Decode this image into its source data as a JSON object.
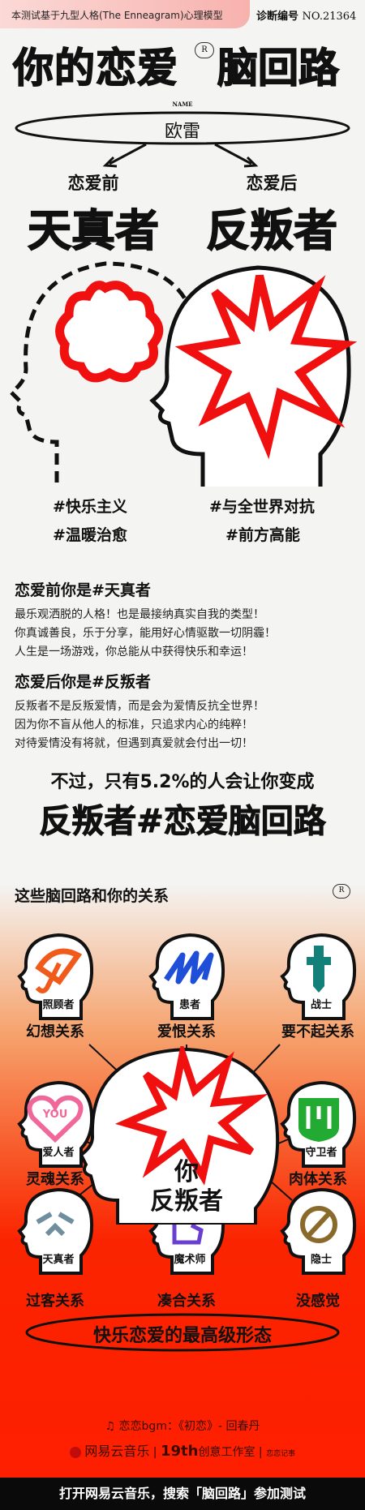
{
  "header": {
    "banner": "本测试基于九型人格(The Enneagram)心理模型",
    "diag_label": "诊断编号",
    "diag_no": "NO.21364"
  },
  "title": {
    "part1": "你的恋爱",
    "part2": "脑回路",
    "badge": "R"
  },
  "name": {
    "label": "NAME",
    "value": "欧雷"
  },
  "before": {
    "label": "恋爱前",
    "type": "天真者",
    "tags": [
      "#快乐主义",
      "#温暖治愈"
    ]
  },
  "after": {
    "label": "恋爱后",
    "type": "反叛者",
    "tags": [
      "#与全世界对抗",
      "#前方高能"
    ]
  },
  "desc": [
    {
      "heading": "恋爱前你是#天真者",
      "lines": [
        "最乐观洒脱的人格！也是最接纳真实自我的类型！",
        "你真诚善良，乐于分享，能用好心情驱散一切阴霾！",
        "人生是一场游戏，你总能从中获得快乐和幸运！"
      ]
    },
    {
      "heading": "恋爱后你是#反叛者",
      "lines": [
        "反叛者不是反叛爱情，而是会为爱情反抗全世界！",
        "因为你不盲从他人的标准，只追求内心的纯粹！",
        "对待爱情没有将就，但遇到真爱就会付出一切！"
      ]
    }
  ],
  "rarity": {
    "line1": "不过，只有5.2%的人会让你变成",
    "percent": 5.2,
    "line2": "反叛者#恋爱脑回路"
  },
  "relations": {
    "heading": "这些脑回路和你的关系",
    "center": {
      "you": "你",
      "type": "反叛者"
    },
    "items": [
      {
        "type": "照顾者",
        "relation": "幻想关系",
        "icon": "umbrella-icon",
        "color": "#f05a1a"
      },
      {
        "type": "患者",
        "relation": "爱恨关系",
        "icon": "scribble-icon",
        "color": "#1f4fd8"
      },
      {
        "type": "战士",
        "relation": "要不起关系",
        "icon": "sword-icon",
        "color": "#14807a"
      },
      {
        "type": "爱人者",
        "relation": "灵魂关系",
        "icon": "heart-you-icon",
        "color": "#f0679a",
        "icon_text": "YOU"
      },
      {
        "type": "守卫者",
        "relation": "肉体关系",
        "icon": "shield-icon",
        "color": "#22aa33"
      },
      {
        "type": "天真者",
        "relation": "过客关系",
        "icon": "sparkle-icon",
        "color": "#6f8fa0"
      },
      {
        "type": "魔术师",
        "relation": "凑合关系",
        "icon": "magic-hand-icon",
        "color": "#6a3fd0"
      },
      {
        "type": "隐士",
        "relation": "没感觉",
        "icon": "no-sign-icon",
        "color": "#8a6a2a"
      }
    ]
  },
  "slogan": "快乐恋爱的最高级形态",
  "footer": {
    "bgm": "恋恋bgm：《初恋》- 回春丹",
    "brand1": "网易云音乐",
    "brand2": "19th",
    "brand2_suffix": "创意工作室",
    "brand3": "恋恋记事",
    "cta": "打开网易云音乐，搜索「脑回路」参加测试"
  },
  "colors": {
    "accent": "#fe1f00",
    "banner": "#f7b2ae"
  }
}
